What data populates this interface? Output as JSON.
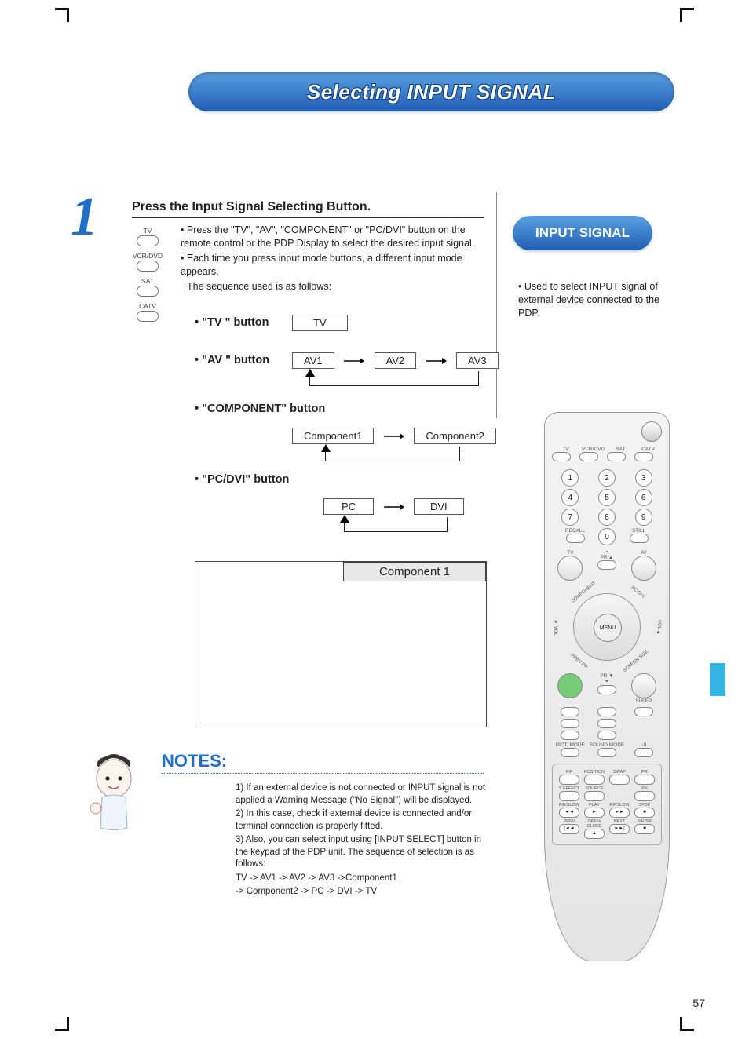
{
  "title": "Selecting INPUT SIGNAL",
  "step_number": "1",
  "step_heading": "Press the Input Signal Selecting Button.",
  "remote_side_buttons": [
    "TV",
    "VCR/DVD",
    "SAT",
    "CATV"
  ],
  "body_bullets": [
    "Press the \"TV\", \"AV\", \"COMPONENT\" or \"PC/DVI\" button on the remote control or the PDP Display to select the desired input signal.",
    "Each time you press input mode buttons, a different input mode appears.",
    "The sequence used is as follows:"
  ],
  "sequences": {
    "tv": {
      "label": "• \"TV \" button",
      "items": [
        "TV"
      ]
    },
    "av": {
      "label": "• \"AV \" button",
      "items": [
        "AV1",
        "AV2",
        "AV3"
      ]
    },
    "comp": {
      "label": "• \"COMPONENT\" button",
      "items": [
        "Component1",
        "Component2"
      ]
    },
    "pcdvi": {
      "label": "• \"PC/DVI\" button",
      "items": [
        "PC",
        "DVI"
      ]
    }
  },
  "screen_label": "Component 1",
  "notes_heading": "NOTES:",
  "notes": [
    "1) If an external device is not connected or INPUT signal is not applied a Warning Message (\"No Signal\") will be displayed.",
    "2) In this case, check if external device is connected and/or terminal connection is properly fitted.",
    "3) Also, you can select input using [INPUT SELECT] button in the keypad of the PDP unit. The sequence of selection is as follows:",
    "TV -> AV1 -> AV2 -> AV3 ->Component1",
    "-> Component2 -> PC -> DVI -> TV"
  ],
  "sidebar": {
    "pill": "INPUT SIGNAL",
    "text": "• Used to select INPUT signal of external device connected to the PDP."
  },
  "remote": {
    "top_row": [
      "TV",
      "VCR/DVD",
      "SAT",
      "CATV"
    ],
    "digits": [
      "1",
      "2",
      "3",
      "4",
      "5",
      "6",
      "7",
      "8",
      "9",
      "0"
    ],
    "recall": "RECALL",
    "still": "STILL",
    "big_labels": [
      "TV",
      "AV"
    ],
    "dpad": {
      "center": "MENU",
      "up": "PR ▲",
      "down": "PR ▼",
      "left_outer": "◄ VOL",
      "right_outer": "VOL ►",
      "ul": "COMPONENT",
      "ur": "PC/DVI",
      "ll": "PREV PR",
      "lr": "SCREEN SIZE"
    },
    "sleep": "SLEEP",
    "mode_row": [
      "PICT. MODE",
      "SOUND MODE",
      "I-II"
    ],
    "sub_rows": [
      [
        "PIP",
        "POSITION",
        "SWAP",
        "PR"
      ],
      [
        "S.EFFECT",
        "SOURCE",
        "",
        "PR"
      ],
      [
        "F.R/SLOW",
        "PLAY",
        "F.F/SLOW",
        "STOP"
      ],
      [
        "PREV",
        "OPEN/ CLOSE",
        "NEXT",
        "PAUSE"
      ]
    ],
    "sub_icons": [
      [
        "",
        "",
        "",
        ""
      ],
      [
        "",
        "",
        "",
        ""
      ],
      [
        "◄◄",
        "►",
        "►►",
        "■"
      ],
      [
        "|◄◄",
        "▲",
        "►►|",
        "■"
      ]
    ]
  },
  "page_number": "57"
}
